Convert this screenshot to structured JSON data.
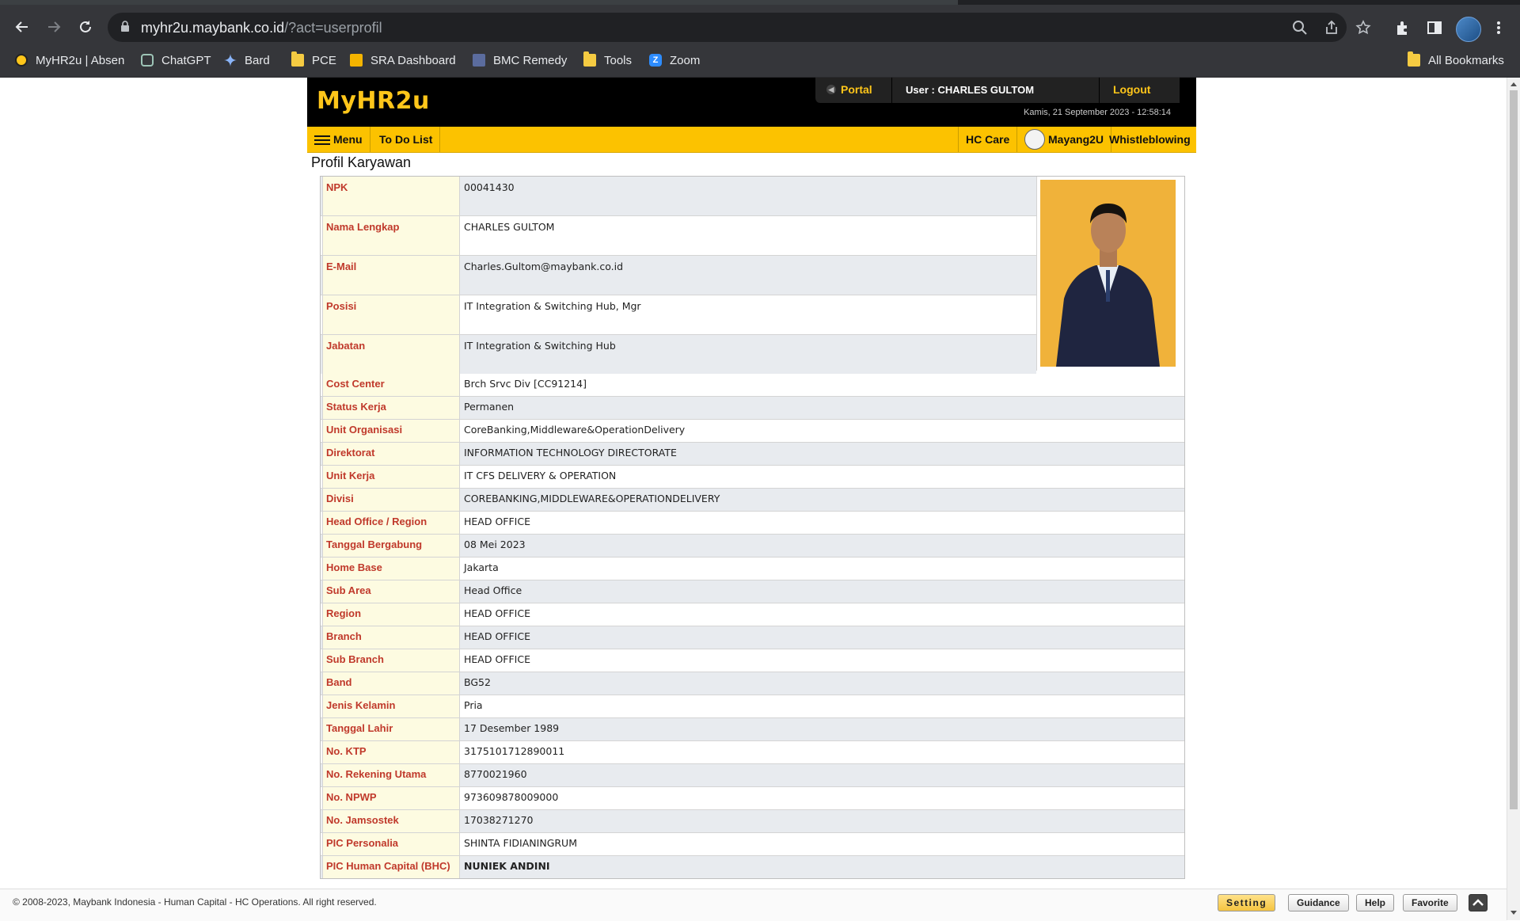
{
  "browser": {
    "url_host": "myhr2u.maybank.co.id",
    "url_path": "/?act=userprofil",
    "bookmarks": [
      {
        "label": "MyHR2u | Absen",
        "icon": "maybank-icon"
      },
      {
        "label": "ChatGPT",
        "icon": "chatgpt-icon"
      },
      {
        "label": "Bard",
        "icon": "bard-icon"
      },
      {
        "label": "PCE",
        "icon": "folder-icon"
      },
      {
        "label": "SRA Dashboard",
        "icon": "dashboard-icon"
      },
      {
        "label": "BMC Remedy",
        "icon": "remedy-icon"
      },
      {
        "label": "Tools",
        "icon": "folder-icon"
      },
      {
        "label": "Zoom",
        "icon": "zoom-icon"
      }
    ],
    "all_bookmarks": "All Bookmarks"
  },
  "header": {
    "logo": "MyHR2u",
    "portal": "Portal",
    "user": "User : CHARLES GULTOM",
    "logout": "Logout",
    "datetime": "Kamis, 21 September 2023 - 12:58:14"
  },
  "menu": {
    "menu": "Menu",
    "todo": "To Do List",
    "hc_care": "HC Care",
    "mayang": "Mayang2U",
    "whistleblowing": "Whistleblowing"
  },
  "page_title": "Profil Karyawan",
  "profile_top": [
    {
      "label": "NPK",
      "value": "00041430"
    },
    {
      "label": "Nama Lengkap",
      "value": "CHARLES GULTOM"
    },
    {
      "label": "E-Mail",
      "value": "Charles.Gultom@maybank.co.id"
    },
    {
      "label": "Posisi",
      "value": "IT Integration & Switching Hub, Mgr"
    },
    {
      "label": "Jabatan",
      "value": "IT Integration & Switching Hub"
    }
  ],
  "profile_rows": [
    {
      "label": "Cost Center",
      "value": "Brch Srvc Div [CC91214]"
    },
    {
      "label": "Status Kerja",
      "value": "Permanen"
    },
    {
      "label": "Unit Organisasi",
      "value": "CoreBanking,Middleware&OperationDelivery"
    },
    {
      "label": "Direktorat",
      "value": "INFORMATION TECHNOLOGY DIRECTORATE"
    },
    {
      "label": "Unit Kerja",
      "value": "IT CFS DELIVERY & OPERATION"
    },
    {
      "label": "Divisi",
      "value": "COREBANKING,MIDDLEWARE&OPERATIONDELIVERY"
    },
    {
      "label": "Head Office / Region",
      "value": "HEAD OFFICE"
    },
    {
      "label": "Tanggal Bergabung",
      "value": "08 Mei 2023"
    },
    {
      "label": "Home Base",
      "value": "Jakarta"
    },
    {
      "label": "Sub Area",
      "value": "Head Office"
    },
    {
      "label": "Region",
      "value": "HEAD OFFICE"
    },
    {
      "label": "Branch",
      "value": "HEAD OFFICE"
    },
    {
      "label": "Sub Branch",
      "value": "HEAD OFFICE"
    },
    {
      "label": "Band",
      "value": "BG52"
    },
    {
      "label": "Jenis Kelamin",
      "value": "Pria"
    },
    {
      "label": "Tanggal Lahir",
      "value": "17 Desember 1989"
    },
    {
      "label": "No. KTP",
      "value": "3175101712890011"
    },
    {
      "label": "No. Rekening Utama",
      "value": "8770021960"
    },
    {
      "label": "No. NPWP",
      "value": "973609878009000"
    },
    {
      "label": "No. Jamsostek",
      "value": "17038271270"
    },
    {
      "label": "PIC Personalia",
      "value": "SHINTA FIDIANINGRUM"
    },
    {
      "label": "PIC Human Capital (BHC)",
      "value": "NUNIEK ANDINI"
    }
  ],
  "footer": {
    "copyright": "© 2008-2023, Maybank Indonesia - Human Capital - HC Operations. All right reserved.",
    "setting": "Setting",
    "guidance": "Guidance",
    "help": "Help",
    "favorite": "Favorite"
  }
}
